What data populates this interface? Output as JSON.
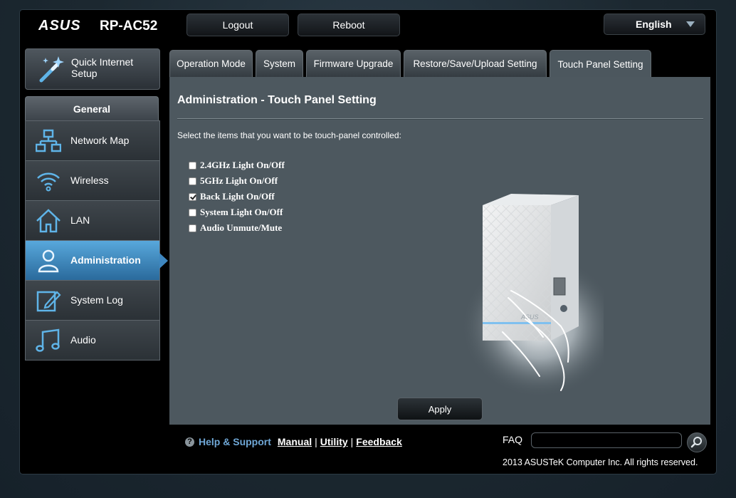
{
  "header": {
    "brand": "ASUS",
    "model": "RP-AC52",
    "logout_label": "Logout",
    "reboot_label": "Reboot",
    "language": "English"
  },
  "sidebar": {
    "qis_label": "Quick Internet Setup",
    "general_title": "General",
    "items": [
      {
        "label": "Network Map",
        "icon": "network-map-icon"
      },
      {
        "label": "Wireless",
        "icon": "wifi-icon"
      },
      {
        "label": "LAN",
        "icon": "home-icon"
      },
      {
        "label": "Administration",
        "icon": "user-icon",
        "active": true
      },
      {
        "label": "System Log",
        "icon": "log-edit-icon"
      },
      {
        "label": "Audio",
        "icon": "music-note-icon"
      }
    ]
  },
  "tabs": [
    {
      "label": "Operation Mode"
    },
    {
      "label": "System"
    },
    {
      "label": "Firmware Upgrade"
    },
    {
      "label": "Restore/Save/Upload Setting"
    },
    {
      "label": "Touch Panel Setting",
      "active": true
    }
  ],
  "main": {
    "title": "Administration - Touch Panel Setting",
    "description": "Select the items that you want to be touch-panel controlled:",
    "options": [
      {
        "label": "2.4GHz Light On/Off",
        "checked": false
      },
      {
        "label": "5GHz Light On/Off",
        "checked": false
      },
      {
        "label": "Back Light On/Off",
        "checked": true
      },
      {
        "label": "System Light On/Off",
        "checked": false
      },
      {
        "label": "Audio Unmute/Mute",
        "checked": false
      }
    ],
    "device_logo": "ASUS",
    "apply_label": "Apply"
  },
  "footer": {
    "help_icon": "?",
    "help_support": "Help & Support",
    "manual": "Manual",
    "utility": "Utility",
    "feedback": "Feedback",
    "separator": "|",
    "faq_label": "FAQ",
    "faq_value": "",
    "copyright": "2013 ASUSTeK Computer Inc. All rights reserved."
  },
  "colors": {
    "accent": "#3e86bf",
    "panel_bg": "#4d585f",
    "help_link": "#6fa7d6"
  }
}
